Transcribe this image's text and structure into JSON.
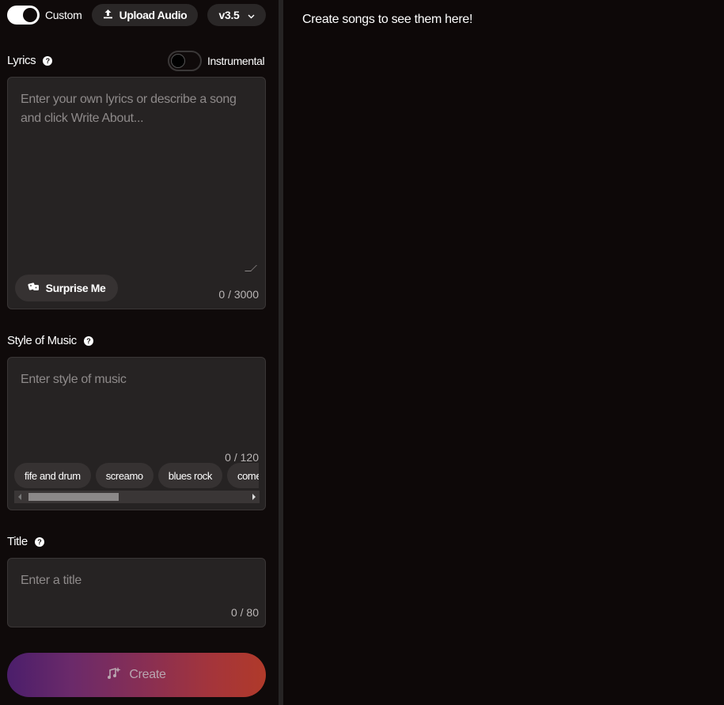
{
  "top_bar": {
    "custom_toggle_label": "Custom",
    "upload_label": "Upload Audio",
    "version_label": "v3.5"
  },
  "lyrics": {
    "label": "Lyrics",
    "instrumental_label": "Instrumental",
    "placeholder": "Enter your own lyrics or describe a song and click Write About...",
    "surprise_label": "Surprise Me",
    "counter": "0 / 3000"
  },
  "style": {
    "label": "Style of Music",
    "placeholder": "Enter style of music",
    "counter": "0 / 120",
    "tags": [
      "fife and drum",
      "screamo",
      "blues rock",
      "comedy"
    ]
  },
  "title": {
    "label": "Title",
    "placeholder": "Enter a title",
    "counter": "0 / 80"
  },
  "create_label": "Create",
  "main": {
    "empty_message": "Create songs to see them here!"
  }
}
